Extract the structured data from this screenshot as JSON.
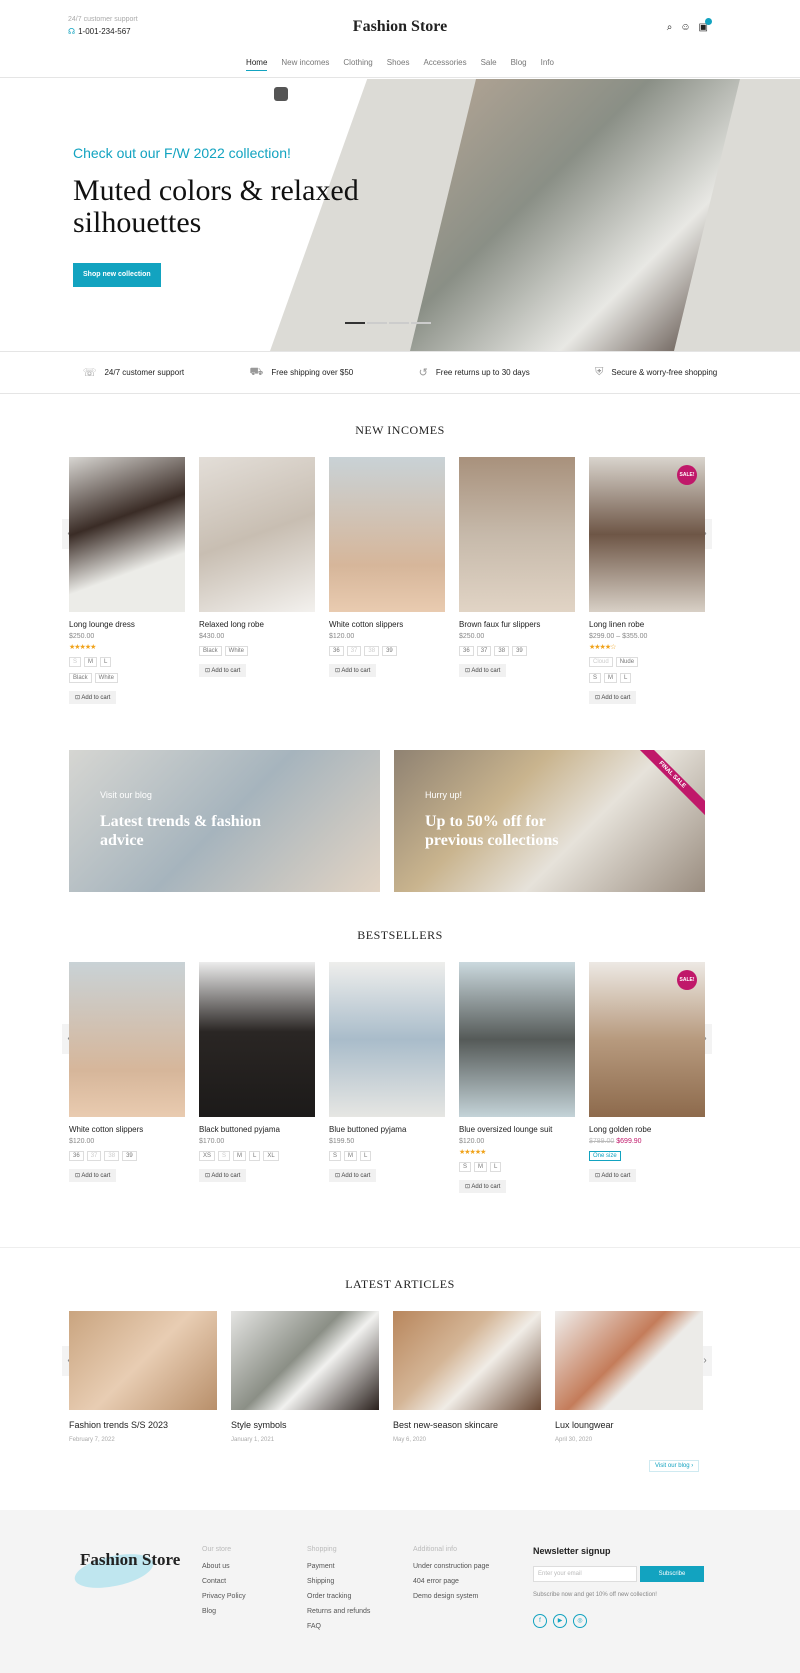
{
  "header": {
    "support_label": "24/7 customer support",
    "phone": "1-001-234-567",
    "logo": "Fashion Store",
    "icons": [
      "search-icon",
      "user-icon",
      "cart-icon"
    ]
  },
  "nav": [
    "Home",
    "New incomes",
    "Clothing",
    "Shoes",
    "Accessories",
    "Sale",
    "Blog",
    "Info"
  ],
  "hero": {
    "pre": "Check out our F/W 2022 collection!",
    "heading": "Muted colors & relaxed silhouettes",
    "button": "Shop new collection"
  },
  "features": [
    {
      "icon": "headset-icon",
      "text": "24/7 customer support"
    },
    {
      "icon": "truck-icon",
      "text": "Free shipping over $50"
    },
    {
      "icon": "return-icon",
      "text": "Free returns up to 30 days"
    },
    {
      "icon": "shield-icon",
      "text": "Secure & worry-free shopping"
    }
  ],
  "new_incomes": {
    "title": "NEW INCOMES",
    "products": [
      {
        "name": "Long lounge dress",
        "price": "$250.00",
        "stars": "★★★★★",
        "sizes": [
          "S",
          "M",
          "L"
        ],
        "colors": [
          "Black",
          "White"
        ],
        "cart": "Add to cart"
      },
      {
        "name": "Relaxed long robe",
        "price": "$430.00",
        "colors": [
          "Black",
          "White"
        ],
        "cart": "Add to cart"
      },
      {
        "name": "White cotton slippers",
        "price": "$120.00",
        "sizes": [
          "36",
          "37",
          "38",
          "39"
        ],
        "cart": "Add to cart"
      },
      {
        "name": "Brown faux fur slippers",
        "price": "$250.00",
        "sizes": [
          "36",
          "37",
          "38",
          "39"
        ],
        "cart": "Add to cart"
      },
      {
        "name": "Long linen robe",
        "price": "$299.00 – $355.00",
        "stars": "★★★★☆",
        "colors": [
          "Cloud",
          "Nude"
        ],
        "sizes": [
          "S",
          "M",
          "L"
        ],
        "cart": "Add to cart",
        "badge": "SALE!"
      }
    ]
  },
  "banners": [
    {
      "sub": "Visit our blog",
      "title": "Latest trends & fashion advice"
    },
    {
      "sub": "Hurry up!",
      "title": "Up to 50% off for previous collections",
      "ribbon": "FINAL SALE"
    }
  ],
  "bestsellers": {
    "title": "BESTSELLERS",
    "products": [
      {
        "name": "White cotton slippers",
        "price": "$120.00",
        "sizes": [
          "36",
          "37",
          "38",
          "39"
        ],
        "cart": "Add to cart"
      },
      {
        "name": "Black buttoned pyjama",
        "price": "$170.00",
        "sizes": [
          "XS",
          "S",
          "M",
          "L",
          "XL"
        ],
        "cart": "Add to cart"
      },
      {
        "name": "Blue buttoned pyjama",
        "price": "$199.50",
        "sizes": [
          "S",
          "M",
          "L"
        ],
        "cart": "Add to cart"
      },
      {
        "name": "Blue oversized lounge suit",
        "price": "$120.00",
        "stars": "★★★★★",
        "sizes": [
          "S",
          "M",
          "L"
        ],
        "cart": "Add to cart"
      },
      {
        "name": "Long golden robe",
        "price_old": "$789.00",
        "price": "$699.90",
        "sizes": [
          "One size"
        ],
        "cart": "Add to cart",
        "badge": "SALE!"
      }
    ]
  },
  "articles": {
    "title": "LATEST ARTICLES",
    "items": [
      {
        "title": "Fashion trends S/S 2023",
        "date": "February 7, 2022"
      },
      {
        "title": "Style symbols",
        "date": "January 1, 2021"
      },
      {
        "title": "Best new-season skincare",
        "date": "May 6, 2020"
      },
      {
        "title": "Lux loungwear",
        "date": "April 30, 2020"
      }
    ],
    "visit": "Visit our blog"
  },
  "footer": {
    "logo": "Fashion Store",
    "columns": [
      {
        "head": "Our store",
        "links": [
          "About us",
          "Contact",
          "Privacy Policy",
          "Blog"
        ]
      },
      {
        "head": "Shopping",
        "links": [
          "Payment",
          "Shipping",
          "Order tracking",
          "Returns and refunds",
          "FAQ"
        ]
      },
      {
        "head": "Additional info",
        "links": [
          "Under construction page",
          "404 error page",
          "Demo design system"
        ]
      }
    ],
    "newsletter": {
      "title": "Newsletter signup",
      "placeholder": "Enter your email",
      "button": "Subscribe",
      "text": "Subscribe now and get 10% off new collection!"
    },
    "social": [
      "facebook-icon",
      "youtube-icon",
      "instagram-icon"
    ]
  },
  "colors": {
    "accent": "#12a3c0",
    "sale": "#c0186a"
  }
}
